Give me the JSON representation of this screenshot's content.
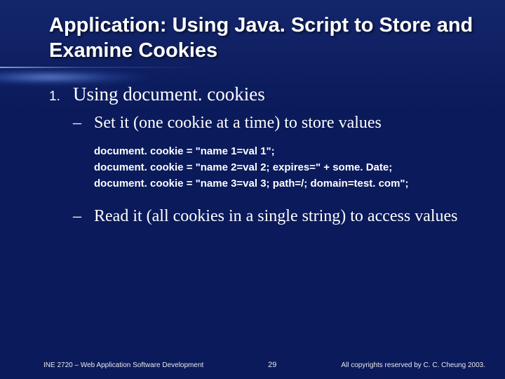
{
  "title": "Application: Using Java. Script to Store and Examine Cookies",
  "list": {
    "number": "1.",
    "heading": "Using document. cookies",
    "bullets": [
      "Set it (one cookie at a time) to store values",
      "Read it (all cookies in a single string) to access values"
    ]
  },
  "code": [
    "document. cookie = \"name 1=val 1\";",
    "document. cookie = \"name 2=val 2; expires=\" + some. Date;",
    "document. cookie = \"name 3=val 3; path=/; domain=test. com\";"
  ],
  "footer": {
    "left": "INE 2720 – Web Application Software Development",
    "page": "29",
    "right": "All copyrights reserved by C. C. Cheung 2003."
  }
}
